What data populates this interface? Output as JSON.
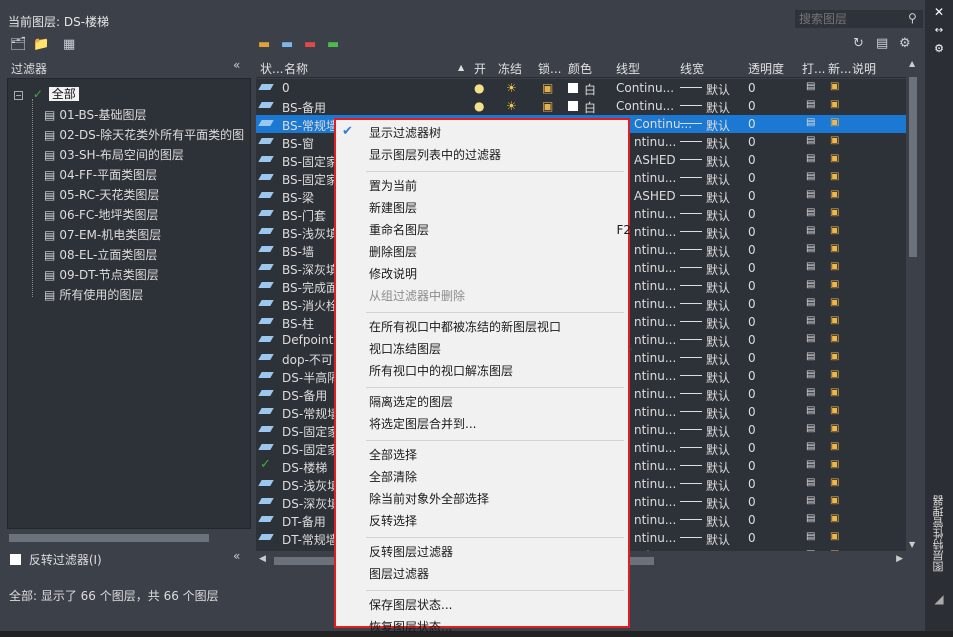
{
  "header": {
    "current_layer": "当前图层: DS-楼梯"
  },
  "search": {
    "placeholder": "搜索图层"
  },
  "filters": {
    "title": "过滤器",
    "root": "全部",
    "items": [
      "01-BS-基础图层",
      "02-DS-除天花类外所有平面类的图",
      "03-SH-布局空间的图层",
      "04-FF-平面类图层",
      "05-RC-天花类图层",
      "06-FC-地坪类图层",
      "07-EM-机电类图层",
      "08-EL-立面类图层",
      "09-DT-节点类图层",
      "所有使用的图层"
    ],
    "invert_label": "反转过滤器(I)"
  },
  "columns": [
    "状...",
    "名称",
    "开",
    "冻结",
    "锁...",
    "颜色",
    "线型",
    "线宽",
    "透明度",
    "打...",
    "新...",
    "说明"
  ],
  "rows": [
    {
      "name": "0",
      "color": "白",
      "linetype": "Continu...",
      "lw": "默认",
      "tr": "0"
    },
    {
      "name": "BS-备用",
      "color": "白",
      "linetype": "Continu...",
      "lw": "默认",
      "tr": "0"
    },
    {
      "name": "BS-常规墙",
      "color": "",
      "linetype": "Continu...",
      "lw": "默认",
      "tr": "0"
    },
    {
      "name": "BS-窗",
      "color": "",
      "linetype": "ntinu...",
      "lw": "默认",
      "tr": "0"
    },
    {
      "name": "BS-固定家",
      "color": "",
      "linetype": "ASHED",
      "lw": "默认",
      "tr": "0"
    },
    {
      "name": "BS-固定家",
      "color": "",
      "linetype": "ntinu...",
      "lw": "默认",
      "tr": "0"
    },
    {
      "name": "BS-梁",
      "color": "",
      "linetype": "ASHED",
      "lw": "默认",
      "tr": "0"
    },
    {
      "name": "BS-门套",
      "color": "",
      "linetype": "ntinu...",
      "lw": "默认",
      "tr": "0"
    },
    {
      "name": "BS-浅灰填",
      "color": "",
      "linetype": "ntinu...",
      "lw": "默认",
      "tr": "0"
    },
    {
      "name": "BS-墙",
      "color": "",
      "linetype": "ntinu...",
      "lw": "默认",
      "tr": "0"
    },
    {
      "name": "BS-深灰填",
      "color": "",
      "linetype": "ntinu...",
      "lw": "默认",
      "tr": "0"
    },
    {
      "name": "BS-完成面",
      "color": "",
      "linetype": "ntinu...",
      "lw": "默认",
      "tr": "0"
    },
    {
      "name": "BS-消火栓",
      "color": "",
      "linetype": "ntinu...",
      "lw": "默认",
      "tr": "0"
    },
    {
      "name": "BS-柱",
      "color": "",
      "linetype": "ntinu...",
      "lw": "默认",
      "tr": "0"
    },
    {
      "name": "Defpoint",
      "color": "",
      "linetype": "ntinu...",
      "lw": "默认",
      "tr": "0"
    },
    {
      "name": "dop-不可",
      "color": "",
      "linetype": "ntinu...",
      "lw": "默认",
      "tr": "0"
    },
    {
      "name": "DS-半高隔",
      "color": "",
      "linetype": "ntinu...",
      "lw": "默认",
      "tr": "0"
    },
    {
      "name": "DS-备用",
      "color": "",
      "linetype": "ntinu...",
      "lw": "默认",
      "tr": "0"
    },
    {
      "name": "DS-常规墙",
      "color": "",
      "linetype": "ntinu...",
      "lw": "默认",
      "tr": "0"
    },
    {
      "name": "DS-固定家",
      "color": "",
      "linetype": "ntinu...",
      "lw": "默认",
      "tr": "0"
    },
    {
      "name": "DS-固定家",
      "color": "",
      "linetype": "ntinu...",
      "lw": "默认",
      "tr": "0"
    },
    {
      "name": "DS-楼梯",
      "color": "",
      "linetype": "ntinu...",
      "lw": "默认",
      "tr": "0"
    },
    {
      "name": "DS-浅灰填",
      "color": "",
      "linetype": "ntinu...",
      "lw": "默认",
      "tr": "0"
    },
    {
      "name": "DS-深灰填",
      "color": "",
      "linetype": "ntinu...",
      "lw": "默认",
      "tr": "0"
    },
    {
      "name": "DT-备用",
      "color": "",
      "linetype": "ntinu...",
      "lw": "默认",
      "tr": "0"
    },
    {
      "name": "DT-常规墙",
      "color": "",
      "linetype": "ntinu...",
      "lw": "默认",
      "tr": "0"
    },
    {
      "name": "DT-浅灰填",
      "color": "",
      "linetype": "ntinu...",
      "lw": "默认",
      "tr": "0"
    }
  ],
  "status": "全部: 显示了 66 个图层，共 66 个图层",
  "side_title": "图层特性管理器",
  "menu": {
    "items": [
      {
        "label": "显示过滤器树",
        "checked": true
      },
      {
        "label": "显示图层列表中的过滤器"
      },
      {
        "sep": true
      },
      {
        "label": "置为当前"
      },
      {
        "label": "新建图层"
      },
      {
        "label": "重命名图层",
        "shortcut": "F2"
      },
      {
        "label": "删除图层"
      },
      {
        "label": "修改说明"
      },
      {
        "label": "从组过滤器中删除",
        "disabled": true
      },
      {
        "sep": true
      },
      {
        "label": "在所有视口中都被冻结的新图层视口"
      },
      {
        "label": "视口冻结图层",
        "submenu": true
      },
      {
        "label": "所有视口中的视口解冻图层"
      },
      {
        "sep": true
      },
      {
        "label": "隔离选定的图层"
      },
      {
        "label": "将选定图层合并到..."
      },
      {
        "sep": true
      },
      {
        "label": "全部选择"
      },
      {
        "label": "全部清除"
      },
      {
        "label": "除当前对象外全部选择"
      },
      {
        "label": "反转选择"
      },
      {
        "sep": true
      },
      {
        "label": "反转图层过滤器"
      },
      {
        "label": "图层过滤器",
        "submenu": true
      },
      {
        "sep": true
      },
      {
        "label": "保存图层状态..."
      },
      {
        "label": "恢复图层状态..."
      }
    ]
  },
  "colors": {
    "selected": "#1b79d4",
    "menu_border": "#e02020",
    "check": "#2f7fd1",
    "current_layer_check": "#3fae3f"
  }
}
